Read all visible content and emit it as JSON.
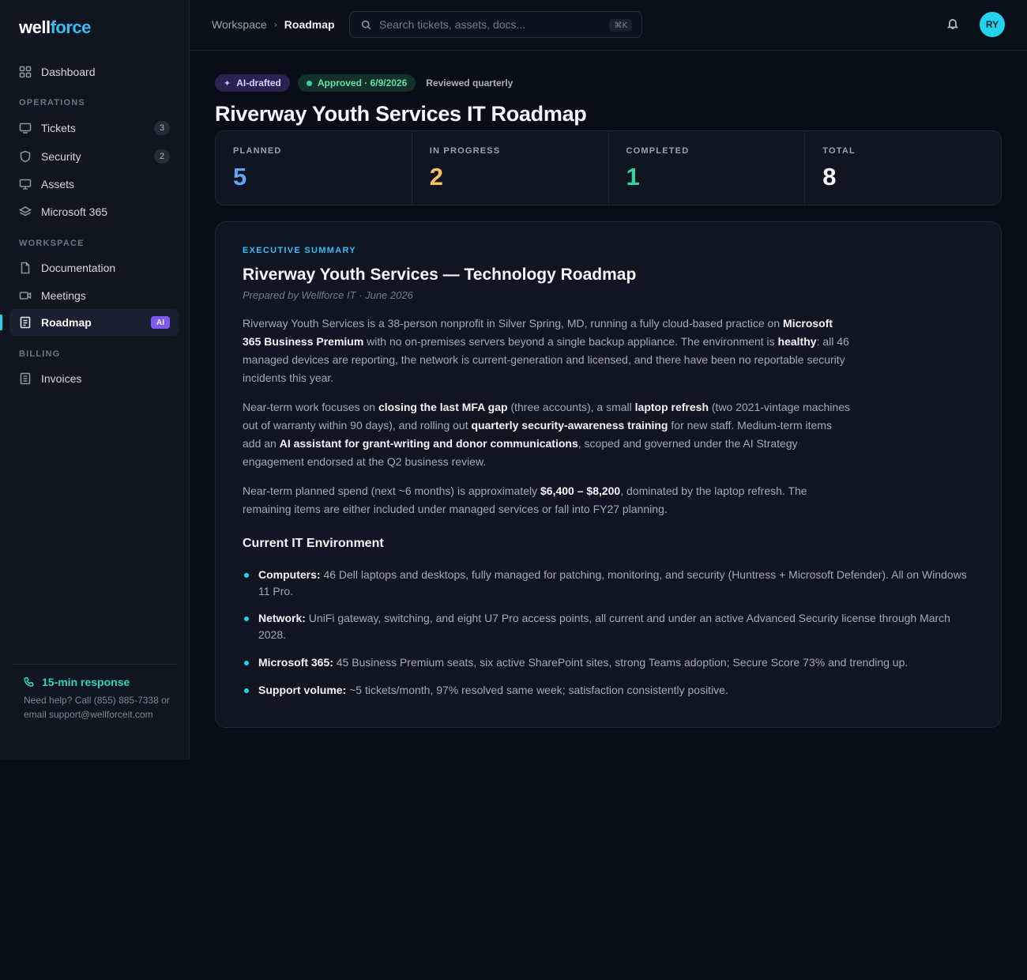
{
  "brand": {
    "part1": "well",
    "part2": "force"
  },
  "sidebar": {
    "dashboard": "Dashboard",
    "sections": {
      "operations": "OPERATIONS",
      "workspace": "WORKSPACE",
      "billing": "BILLING"
    },
    "items": {
      "tickets": {
        "label": "Tickets",
        "count": "3"
      },
      "security": {
        "label": "Security",
        "count": "2"
      },
      "assets": {
        "label": "Assets"
      },
      "m365": {
        "label": "Microsoft 365"
      },
      "documentation": {
        "label": "Documentation"
      },
      "meetings": {
        "label": "Meetings"
      },
      "roadmap": {
        "label": "Roadmap",
        "badge": "AI"
      },
      "invoices": {
        "label": "Invoices"
      }
    },
    "help": {
      "title": "15-min response",
      "text": "Need help? Call (855) 885-7338 or email support@wellforceit.com"
    }
  },
  "topbar": {
    "breadcrumb": {
      "parent": "Workspace",
      "sep": "›",
      "current": "Roadmap"
    },
    "search_placeholder": "Search tickets, assets, docs...",
    "search_shortcut": "⌘K",
    "avatar_initials": "RY"
  },
  "header": {
    "badges": {
      "ai": "AI-drafted",
      "approved": "Approved · 6/9/2026",
      "review": "Reviewed quarterly"
    },
    "title": "Riverway Youth Services IT Roadmap"
  },
  "stats": [
    {
      "label": "PLANNED",
      "value": "5",
      "color": "#60a5fa"
    },
    {
      "label": "IN PROGRESS",
      "value": "2",
      "color": "#fbbf62"
    },
    {
      "label": "COMPLETED",
      "value": "1",
      "color": "#34d399"
    },
    {
      "label": "TOTAL",
      "value": "8",
      "color": "#f3f5f9"
    }
  ],
  "summary": {
    "eyebrow": "EXECUTIVE SUMMARY",
    "title": "Riverway Youth Services — Technology Roadmap",
    "subtitle": "Prepared by Wellforce IT · June 2026",
    "p1": {
      "a": "Riverway Youth Services is a 38-person nonprofit in Silver Spring, MD, running a fully cloud-based practice on ",
      "b1": "Microsoft 365 Business Premium",
      "c": " with no on-premises servers beyond a single backup appliance. The environment is ",
      "b2": "healthy",
      "d": ": all 46 managed devices are reporting, the network is current-generation and licensed, and there have been no reportable security incidents this year."
    },
    "p2": {
      "a": "Near-term work focuses on ",
      "b1": "closing the last MFA gap",
      "c": " (three accounts), a small ",
      "b2": "laptop refresh",
      "d": " (two 2021-vintage machines out of warranty within 90 days), and rolling out ",
      "b3": "quarterly security-awareness training",
      "e": " for new staff. Medium-term items add an ",
      "b4": "AI assistant for grant-writing and donor communications",
      "f": ", scoped and governed under the AI Strategy engagement endorsed at the Q2 business review."
    },
    "p3": {
      "a": "Near-term planned spend (next ~6 months) is approximately ",
      "b1": "$6,400 – $8,200",
      "c": ", dominated by the laptop refresh. The remaining items are either included under managed services or fall into FY27 planning."
    },
    "env_title": "Current IT Environment",
    "env": [
      {
        "label": "Computers:",
        "text": " 46 Dell laptops and desktops, fully managed for patching, monitoring, and security (Huntress + Microsoft Defender). All on Windows 11 Pro."
      },
      {
        "label": "Network:",
        "text": " UniFi gateway, switching, and eight U7 Pro access points, all current and under an active Advanced Security license through March 2028."
      },
      {
        "label": "Microsoft 365:",
        "text": " 45 Business Premium seats, six active SharePoint sites, strong Teams adoption; Secure Score 73% and trending up."
      },
      {
        "label": "Support volume:",
        "text": " ~5 tickets/month, 97% resolved same week; satisfaction consistently positive."
      }
    ]
  }
}
